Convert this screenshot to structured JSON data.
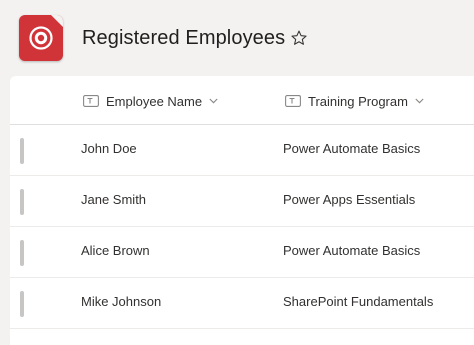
{
  "app": {
    "icon": "lists-app-icon",
    "accent": "#d13438",
    "title": "Registered Employees",
    "favorite_icon": "star-outline-icon"
  },
  "table": {
    "columns": [
      {
        "label": "Employee Name",
        "type_icon": "text-column-icon",
        "menu_icon": "chevron-down-icon"
      },
      {
        "label": "Training Program",
        "type_icon": "text-column-icon",
        "menu_icon": "chevron-down-icon"
      }
    ],
    "rows": [
      {
        "name": "John Doe",
        "program": "Power Automate Basics"
      },
      {
        "name": "Jane Smith",
        "program": "Power Apps Essentials"
      },
      {
        "name": "Alice Brown",
        "program": "Power Automate Basics"
      },
      {
        "name": "Mike Johnson",
        "program": "SharePoint Fundamentals"
      }
    ]
  }
}
